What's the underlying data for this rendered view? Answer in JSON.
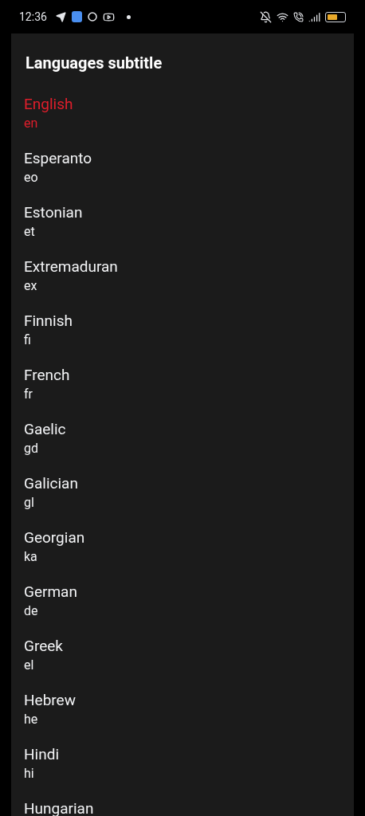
{
  "status_bar": {
    "time": "12:36"
  },
  "dialog": {
    "title": "Languages subtitle",
    "languages": [
      {
        "name": "English",
        "code": "en",
        "selected": true
      },
      {
        "name": "Esperanto",
        "code": "eo",
        "selected": false
      },
      {
        "name": "Estonian",
        "code": "et",
        "selected": false
      },
      {
        "name": "Extremaduran",
        "code": "ex",
        "selected": false
      },
      {
        "name": "Finnish",
        "code": "fi",
        "selected": false
      },
      {
        "name": "French",
        "code": "fr",
        "selected": false
      },
      {
        "name": "Gaelic",
        "code": "gd",
        "selected": false
      },
      {
        "name": "Galician",
        "code": "gl",
        "selected": false
      },
      {
        "name": "Georgian",
        "code": "ka",
        "selected": false
      },
      {
        "name": "German",
        "code": "de",
        "selected": false
      },
      {
        "name": "Greek",
        "code": "el",
        "selected": false
      },
      {
        "name": "Hebrew",
        "code": "he",
        "selected": false
      },
      {
        "name": "Hindi",
        "code": "hi",
        "selected": false
      },
      {
        "name": "Hungarian",
        "selected": false
      }
    ]
  }
}
